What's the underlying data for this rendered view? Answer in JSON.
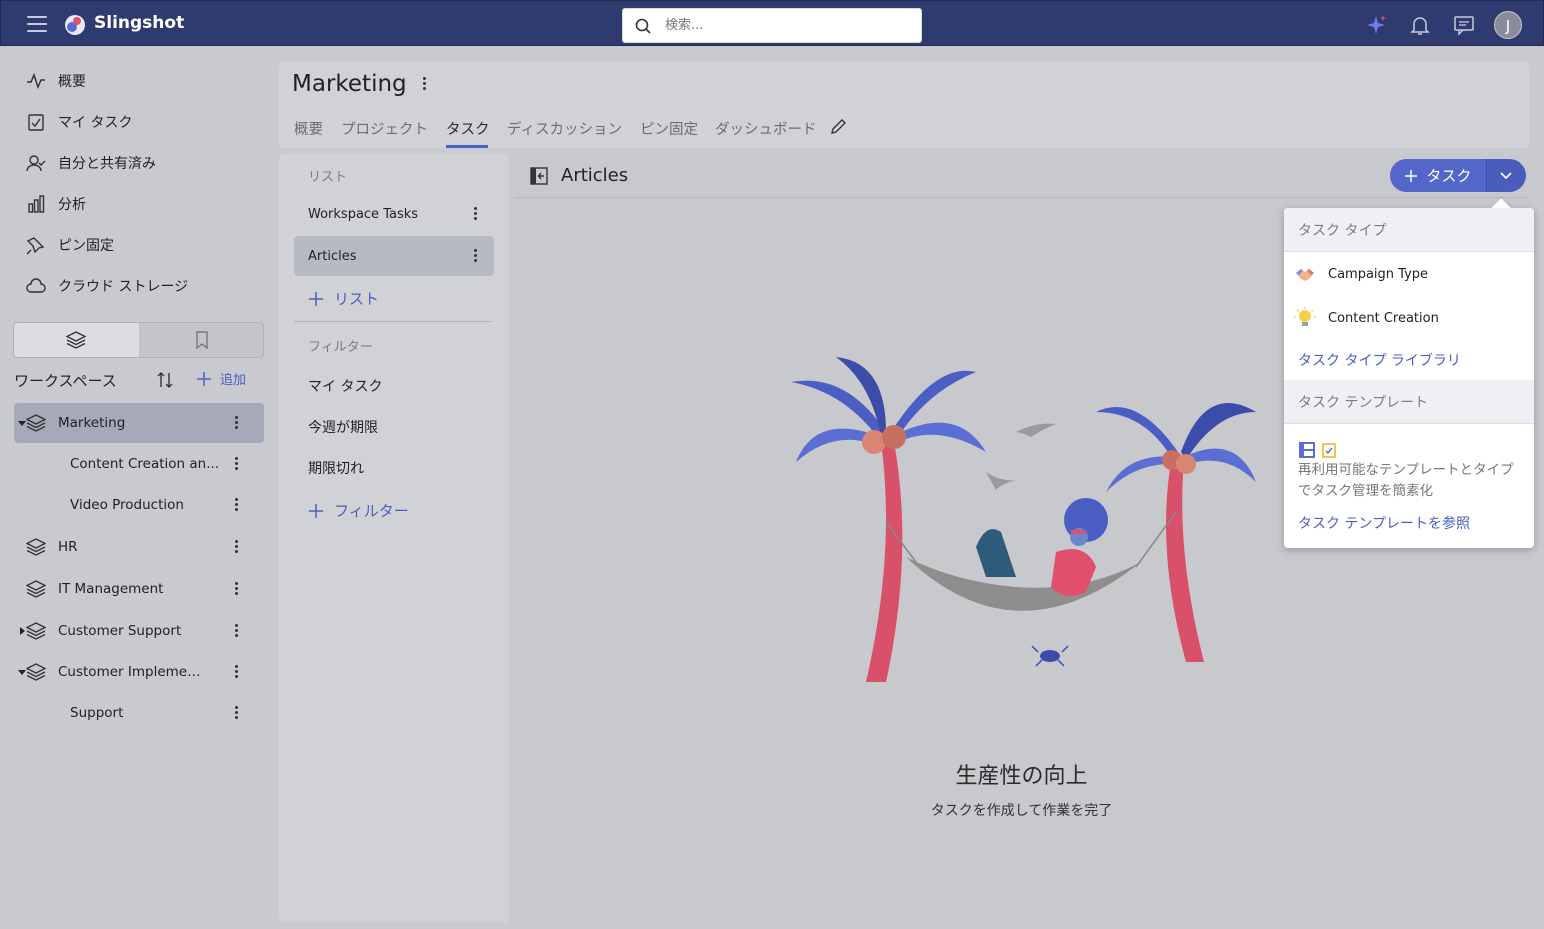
{
  "app": {
    "name": "Slingshot"
  },
  "search": {
    "placeholder": "検索..."
  },
  "user": {
    "initial": "J"
  },
  "nav": [
    {
      "label": "概要",
      "icon": "activity-icon"
    },
    {
      "label": "マイ タスク",
      "icon": "task-check-icon"
    },
    {
      "label": "自分と共有済み",
      "icon": "user-check-icon"
    },
    {
      "label": "分析",
      "icon": "bar-chart-icon"
    },
    {
      "label": "ピン固定",
      "icon": "pin-icon"
    },
    {
      "label": "クラウド ストレージ",
      "icon": "cloud-icon"
    }
  ],
  "workspace": {
    "label": "ワークスペース",
    "add_label": "追加",
    "items": [
      {
        "name": "Marketing"
      },
      {
        "name": "Content Creation an..."
      },
      {
        "name": "Video Production"
      },
      {
        "name": "HR"
      },
      {
        "name": "IT Management"
      },
      {
        "name": "Customer Support"
      },
      {
        "name": "Customer Implementa..."
      },
      {
        "name": "Support"
      }
    ]
  },
  "header": {
    "title": "Marketing",
    "tabs": [
      "概要",
      "プロジェクト",
      "タスク",
      "ディスカッション",
      "ピン固定",
      "ダッシュボード"
    ],
    "active_tab": "タスク"
  },
  "lists": {
    "section_label": "リスト",
    "items": [
      "Workspace Tasks",
      "Articles"
    ],
    "add_label": "リスト",
    "filter_section_label": "フィルター",
    "filters": [
      "マイ タスク",
      "今週が期限",
      "期限切れ"
    ],
    "add_filter_label": "フィルター"
  },
  "main": {
    "title": "Articles",
    "task_button_label": "タスク",
    "empty_title": "生産性の向上",
    "empty_subtitle": "タスクを作成して作業を完了"
  },
  "dropdown": {
    "task_type_header": "タスク タイプ",
    "task_types": [
      {
        "label": "Campaign Type",
        "icon": "handshake-icon"
      },
      {
        "label": "Content Creation",
        "icon": "lightbulb-icon"
      }
    ],
    "library_link": "タスク タイプ ライブラリ",
    "template_header": "タスク テンプレート",
    "template_desc": "再利用可能なテンプレートとタイプでタスク管理を簡素化",
    "template_link": "タスク テンプレートを参照"
  },
  "colors": {
    "topbar": "#2f3a6e",
    "accent": "#4a5fc1",
    "background": "#c9cacf"
  }
}
